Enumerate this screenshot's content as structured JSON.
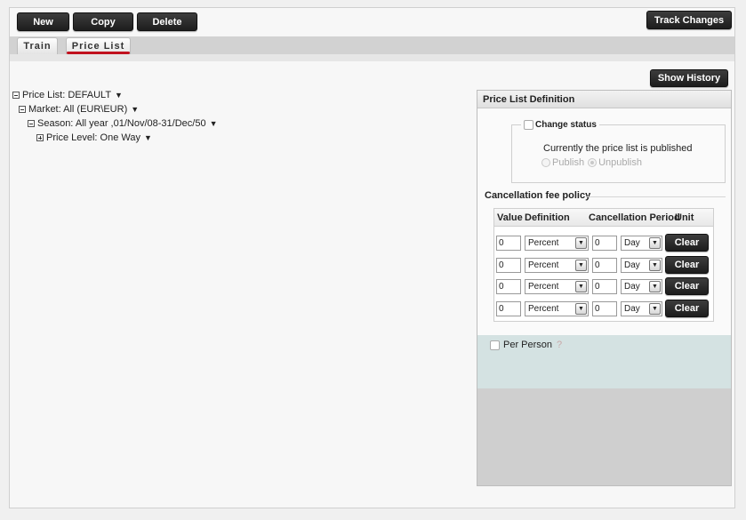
{
  "toolbar": {
    "new_label": "New",
    "copy_label": "Copy",
    "delete_label": "Delete",
    "track_changes_label": "Track Changes"
  },
  "tabs": [
    {
      "label": "Train"
    },
    {
      "label": "Price List"
    }
  ],
  "show_history_label": "Show History",
  "tree": {
    "price_list": "Price List: DEFAULT",
    "market": "Market: All (EUR\\EUR)",
    "season": "Season: All year ,01/Nov/08-31/Dec/50",
    "price_level": "Price Level: One Way",
    "caret": "▼"
  },
  "panel": {
    "title": "Price List Definition",
    "change_status_label": "Change status",
    "status_text": "Currently the price list is published",
    "publish_label": "Publish",
    "unpublish_label": "Unpublish",
    "cancellation_title": "Cancellation fee policy",
    "columns": {
      "value": "Value",
      "definition": "Definition",
      "period": "Cancellation Period",
      "unit": "Unit"
    },
    "rows": [
      {
        "value": "0",
        "definition": "Percent",
        "period": "0",
        "unit": "Day",
        "clear": "Clear"
      },
      {
        "value": "0",
        "definition": "Percent",
        "period": "0",
        "unit": "Day",
        "clear": "Clear"
      },
      {
        "value": "0",
        "definition": "Percent",
        "period": "0",
        "unit": "Day",
        "clear": "Clear"
      },
      {
        "value": "0",
        "definition": "Percent",
        "period": "0",
        "unit": "Day",
        "clear": "Clear"
      }
    ],
    "per_person_label": "Per Person"
  },
  "icons": {
    "dropdown": "chevron-down-icon",
    "help": "help-icon"
  }
}
